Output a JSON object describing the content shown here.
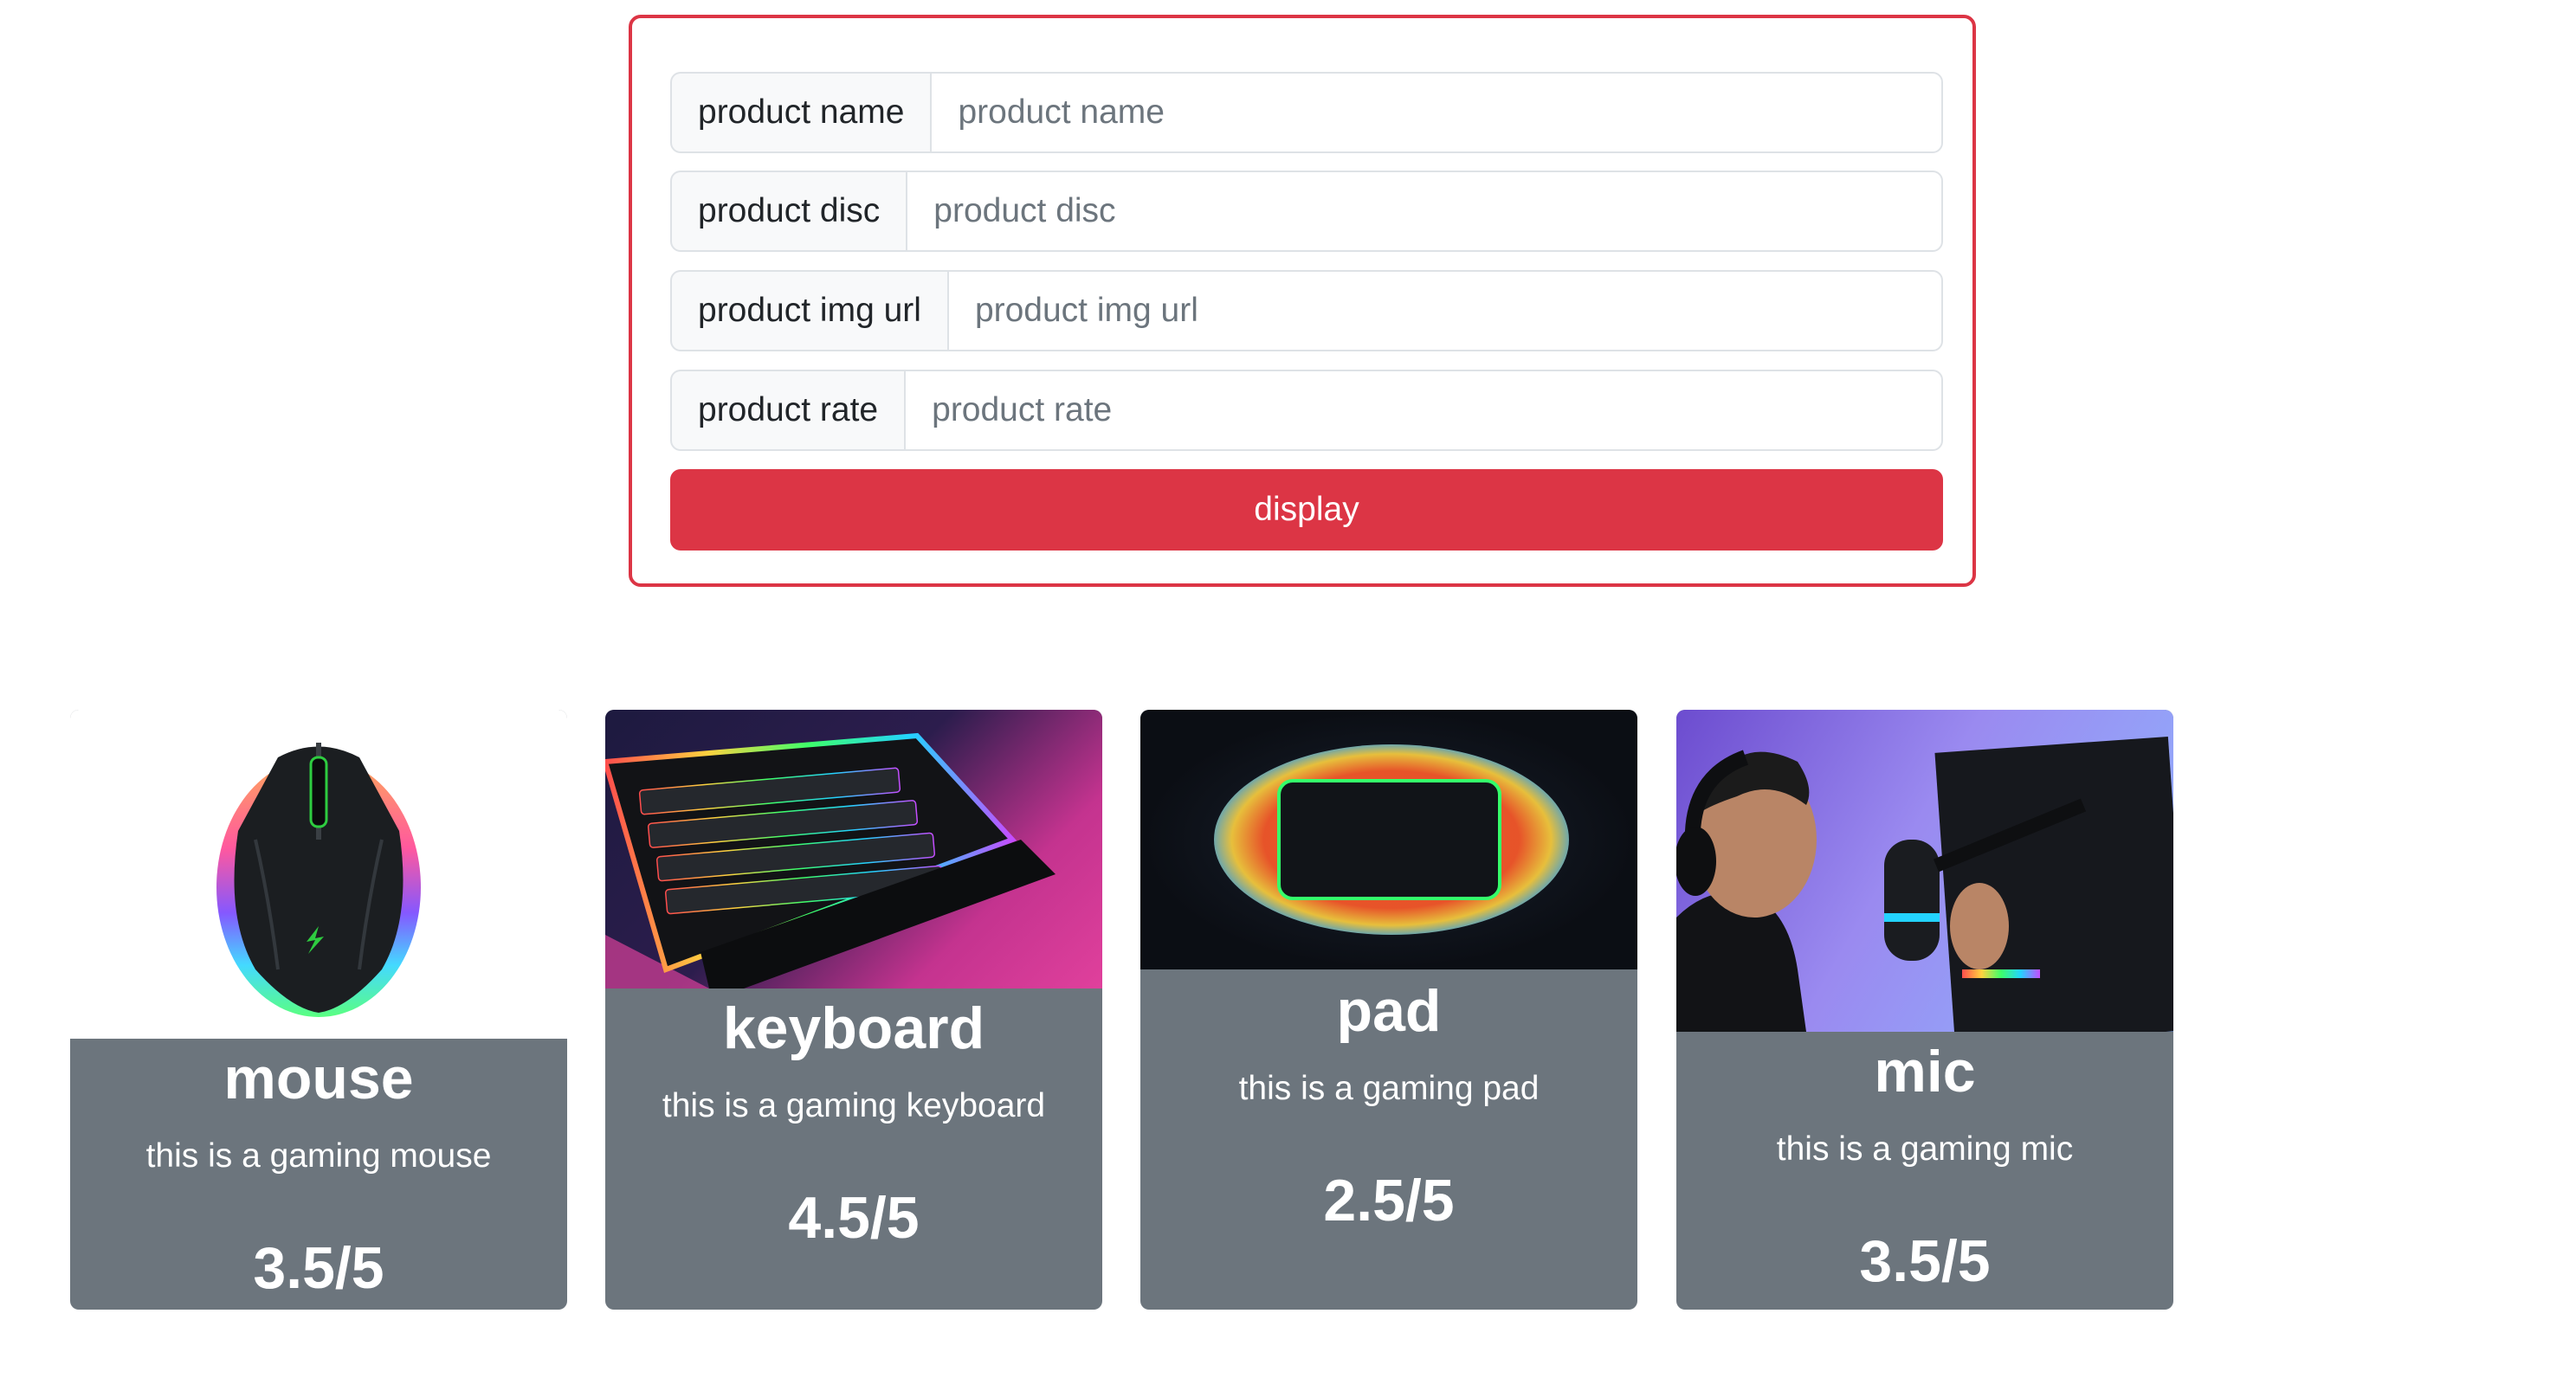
{
  "form": {
    "fields": [
      {
        "label": "product name",
        "placeholder": "product name"
      },
      {
        "label": "product disc",
        "placeholder": "product disc"
      },
      {
        "label": "product img url",
        "placeholder": "product img url"
      },
      {
        "label": "product rate",
        "placeholder": "product rate"
      }
    ],
    "submit_label": "display"
  },
  "cards": [
    {
      "title": "mouse",
      "description": "this is a gaming mouse",
      "rate": "3.5/5",
      "image_icon": "gaming-mouse-image"
    },
    {
      "title": "keyboard",
      "description": "this is a gaming keyboard",
      "rate": "4.5/5",
      "image_icon": "gaming-keyboard-image"
    },
    {
      "title": "pad",
      "description": "this is a gaming pad",
      "rate": "2.5/5",
      "image_icon": "gaming-pad-image"
    },
    {
      "title": "mic",
      "description": "this is a gaming mic",
      "rate": "3.5/5",
      "image_icon": "gaming-mic-image"
    }
  ],
  "colors": {
    "accent": "#dc3545",
    "card_body": "#6c757d",
    "addon_bg": "#f8f9fa",
    "border": "#dee2e6"
  }
}
